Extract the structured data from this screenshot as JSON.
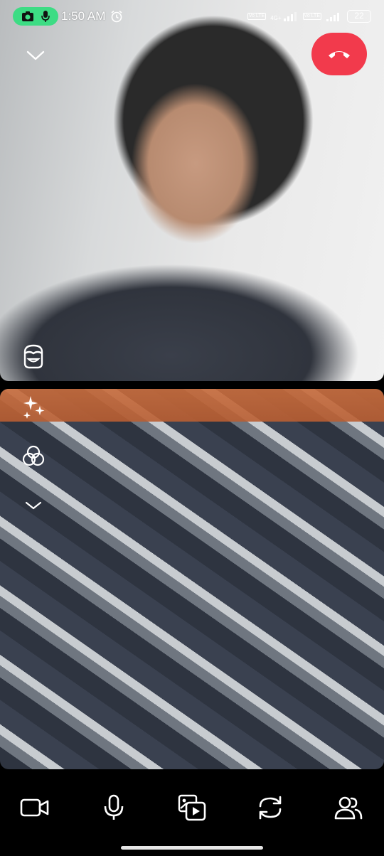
{
  "status_bar": {
    "time": "1:50 AM",
    "volte_1": "Vo LTE",
    "network_1": "4G+",
    "volte_2": "Vo LTE",
    "battery": "22"
  },
  "colors": {
    "end_call": "#f23a4c",
    "recording_pill": "#3ddc84"
  },
  "icons": {
    "top_tile": [
      "collapse-chevron-icon",
      "end-call-icon",
      "avatar-sticker-icon"
    ],
    "bottom_tile": [
      "sparkle-effects-icon",
      "filter-icon",
      "collapse-chevron-icon"
    ],
    "toolbar": [
      "video-camera-icon",
      "microphone-icon",
      "media-share-icon",
      "flip-camera-icon",
      "participants-icon"
    ]
  }
}
